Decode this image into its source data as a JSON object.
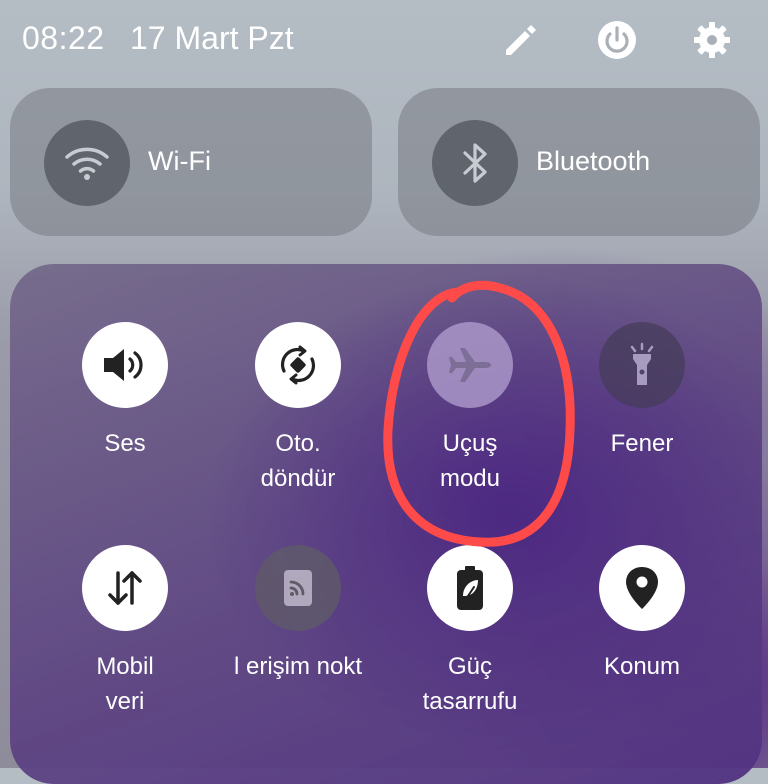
{
  "status": {
    "time": "08:22",
    "date": "17 Mart Pzt"
  },
  "top_tiles": {
    "wifi": {
      "label": "Wi-Fi",
      "icon": "wifi-icon"
    },
    "bluetooth": {
      "label": "Bluetooth",
      "icon": "bluetooth-icon"
    }
  },
  "quick_tiles": [
    {
      "label": "Ses",
      "icon": "volume-icon",
      "state": "on"
    },
    {
      "label": "Oto.\ndöndür",
      "icon": "auto-rotate-icon",
      "state": "on"
    },
    {
      "label": "Uçuş\nmodu",
      "icon": "airplane-icon",
      "state": "off"
    },
    {
      "label": "Fener",
      "icon": "flashlight-icon",
      "state": "off"
    },
    {
      "label": "Mobil\nveri",
      "icon": "mobile-data-icon",
      "state": "on"
    },
    {
      "label": "l erişim nokt",
      "icon": "hotspot-icon",
      "state": "off"
    },
    {
      "label": "Güç\ntasarrufu",
      "icon": "battery-saver-icon",
      "state": "on"
    },
    {
      "label": "Konum",
      "icon": "location-icon",
      "state": "on"
    }
  ],
  "colors": {
    "annotation": "#ff4a4a",
    "tile_active": "#ffffff",
    "panel_accent": "#4b2682"
  }
}
